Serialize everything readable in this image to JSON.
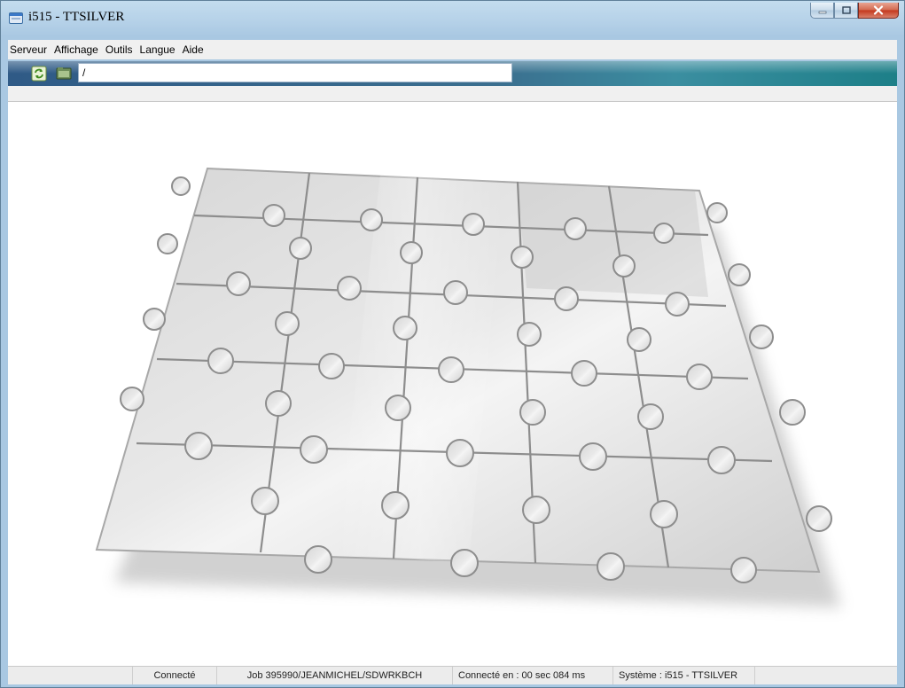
{
  "window": {
    "title": "i515 - TTSILVER"
  },
  "menubar": {
    "items": [
      "Serveur",
      "Affichage",
      "Outils",
      "Langue",
      "Aide"
    ]
  },
  "toolbar": {
    "path_value": "/"
  },
  "statusbar": {
    "connection": "Connecté",
    "job": "Job 395990/JEANMICHEL/SDWRKBCH",
    "connect_time": "Connecté en : 00 sec 084 ms",
    "system": "Système : i515 - TTSILVER"
  },
  "colors": {
    "toolbar_gradient_start": "#2f5a86",
    "toolbar_gradient_end": "#1d7f88",
    "close_button": "#c4371c"
  },
  "icons": [
    "app-window-icon",
    "minimize-icon",
    "maximize-icon",
    "close-icon",
    "refresh-icon",
    "folder-icon"
  ]
}
